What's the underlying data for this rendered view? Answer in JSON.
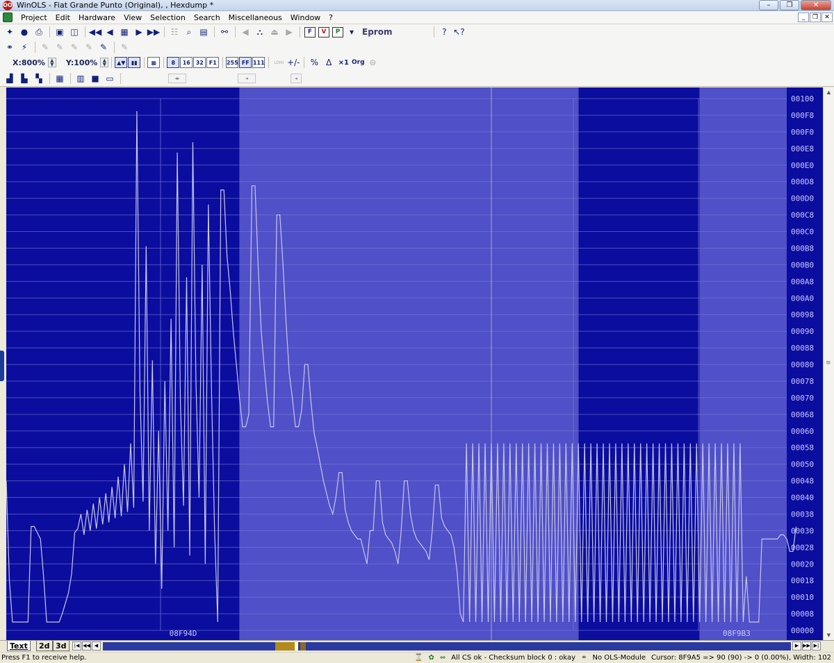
{
  "window": {
    "title": "WinOLS - Fiat Grande Punto (Original), , Hexdump *",
    "app_icon": "ols-app-icon"
  },
  "menu": [
    "Project",
    "Edit",
    "Hardware",
    "View",
    "Selection",
    "Search",
    "Miscellaneous",
    "Window",
    "?"
  ],
  "toolbar1": {
    "eprom_label": "Eprom",
    "f_label": "F",
    "v_label": "V",
    "p_label": "P"
  },
  "toolbar3": {
    "x_zoom": "X:800%",
    "y_zoom": "Y:100%",
    "btn_8": "8",
    "btn_16": "16",
    "btn_32": "32",
    "btn_f1": "F1",
    "btn_255": "255",
    "btn_ff": "FF",
    "btn_111": "111",
    "btn_lohi": "LOHI",
    "btn_x1": "×1",
    "btn_org": "Org"
  },
  "tabs": {
    "text": "Text",
    "d2": "2d",
    "d3": "3d"
  },
  "status": {
    "help": "Press F1 to receive help.",
    "checksum": "All CS ok - Checksum block 0 : okay",
    "module": "No OLS-Module",
    "cursor": "Cursor: 8F9A5 => 90 (90) -> 0 (0.00%), Width: 102"
  },
  "colors": {
    "dark_bg": "#0b0d9e",
    "light_bg": "#5050c8",
    "line": "#c8c8e8",
    "grid": "#7a7ad6"
  },
  "chart_data": {
    "type": "line",
    "x_labels": [
      {
        "text": "08F94D",
        "at": 52
      },
      {
        "text": "08F9B3",
        "at": 230
      }
    ],
    "y_labels": [
      "00100",
      "000F8",
      "000F0",
      "000E8",
      "000E0",
      "000D8",
      "000D0",
      "000C8",
      "000C0",
      "000B8",
      "000B0",
      "000A8",
      "000A0",
      "00098",
      "00090",
      "00088",
      "00080",
      "00078",
      "00070",
      "00068",
      "00060",
      "00058",
      "00050",
      "00048",
      "00040",
      "00038",
      "00030",
      "00028",
      "00020",
      "00018",
      "00010",
      "00008",
      "00000"
    ],
    "ylim": [
      0,
      256
    ],
    "x_count": 251,
    "regions": [
      {
        "from": 0,
        "to": 75,
        "color": "dark"
      },
      {
        "from": 75,
        "to": 184,
        "color": "light"
      },
      {
        "from": 184,
        "to": 223,
        "color": "dark"
      },
      {
        "from": 223,
        "to": 252,
        "color": "light"
      }
    ],
    "cursor_x": 156,
    "values": [
      72,
      24,
      4,
      4,
      4,
      4,
      4,
      4,
      50,
      50,
      47,
      44,
      26,
      4,
      4,
      4,
      4,
      4,
      8,
      13,
      18,
      27,
      47,
      49,
      56,
      46,
      58,
      48,
      61,
      49,
      64,
      51,
      66,
      52,
      69,
      54,
      74,
      55,
      80,
      57,
      90,
      59,
      250,
      115,
      62,
      185,
      48,
      130,
      32,
      96,
      20,
      120,
      48,
      150,
      40,
      230,
      110,
      60,
      170,
      36,
      235,
      120,
      64,
      176,
      32,
      205,
      116,
      48,
      4,
      212,
      212,
      180,
      164,
      144,
      128,
      112,
      98,
      98,
      104,
      214,
      214,
      176,
      144,
      126,
      110,
      98,
      98,
      200,
      200,
      176,
      148,
      124,
      112,
      98,
      98,
      106,
      128,
      128,
      110,
      95,
      88,
      80,
      72,
      66,
      60,
      56,
      64,
      76,
      76,
      58,
      52,
      48,
      46,
      44,
      44,
      38,
      32,
      48,
      48,
      72,
      72,
      52,
      46,
      44,
      42,
      38,
      32,
      48,
      72,
      72,
      56,
      48,
      44,
      42,
      40,
      38,
      34,
      48,
      70,
      70,
      54,
      50,
      48,
      46,
      40,
      28,
      8,
      4,
      90,
      4,
      90,
      4,
      90,
      4,
      90,
      4,
      90,
      4,
      90,
      4,
      90,
      4,
      90,
      4,
      90,
      4,
      90,
      4,
      90,
      4,
      90,
      4,
      90,
      4,
      90,
      4,
      90,
      4,
      90,
      4,
      90,
      4,
      90,
      4,
      90,
      4,
      90,
      4,
      90,
      4,
      90,
      4,
      90,
      4,
      90,
      4,
      90,
      4,
      90,
      4,
      90,
      4,
      90,
      4,
      90,
      4,
      90,
      4,
      90,
      4,
      90,
      4,
      90,
      4,
      90,
      4,
      90,
      4,
      90,
      4,
      90,
      4,
      90,
      4,
      90,
      4,
      90,
      4,
      90,
      4,
      90,
      4,
      90,
      4,
      90,
      4,
      90,
      4,
      26,
      4,
      4,
      4,
      4,
      44,
      44,
      44,
      44,
      44,
      44,
      46,
      46,
      44,
      38,
      38,
      50
    ]
  }
}
